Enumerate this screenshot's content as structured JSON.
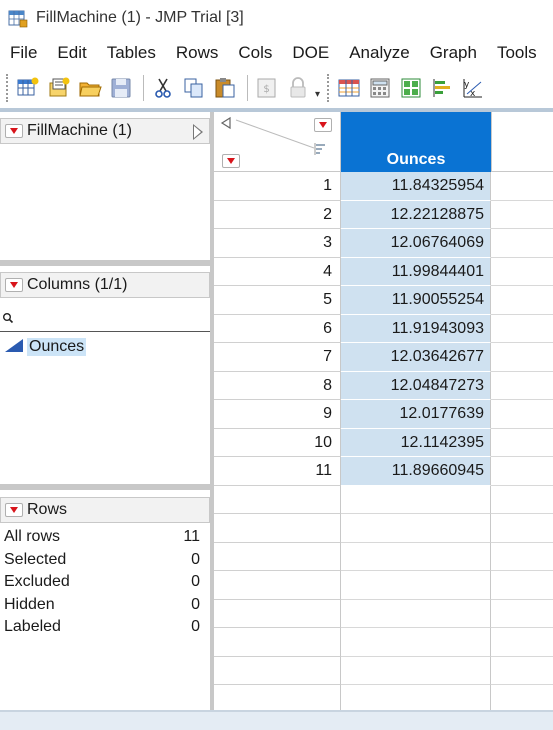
{
  "window": {
    "title": "FillMachine (1) - JMP Trial [3]"
  },
  "menu": [
    "File",
    "Edit",
    "Tables",
    "Rows",
    "Cols",
    "DOE",
    "Analyze",
    "Graph",
    "Tools"
  ],
  "toolbar": {
    "buttons": [
      "new-data-table-icon",
      "new-script-icon",
      "open-folder-icon",
      "save-icon",
      "cut-icon",
      "copy-icon",
      "paste-icon",
      "journal-icon",
      "lock-icon",
      "data-table-icon",
      "calculator-icon",
      "layout-icon",
      "bar-chart-icon",
      "regression-icon"
    ]
  },
  "table_panel": {
    "title": "FillMachine (1)"
  },
  "columns_panel": {
    "title": "Columns (1/1)",
    "search_placeholder": "",
    "items": [
      {
        "name": "Ounces",
        "type": "continuous"
      }
    ]
  },
  "rows_panel": {
    "title": "Rows",
    "stats": [
      {
        "label": "All rows",
        "value": "11"
      },
      {
        "label": "Selected",
        "value": "0"
      },
      {
        "label": "Excluded",
        "value": "0"
      },
      {
        "label": "Hidden",
        "value": "0"
      },
      {
        "label": "Labeled",
        "value": "0"
      }
    ]
  },
  "grid": {
    "column_header": "Ounces",
    "rows": [
      {
        "n": "1",
        "value": "11.84325954"
      },
      {
        "n": "2",
        "value": "12.22128875"
      },
      {
        "n": "3",
        "value": "12.06764069"
      },
      {
        "n": "4",
        "value": "11.99844401"
      },
      {
        "n": "5",
        "value": "11.90055254"
      },
      {
        "n": "6",
        "value": "11.91943093"
      },
      {
        "n": "7",
        "value": "12.03642677"
      },
      {
        "n": "8",
        "value": "12.04847273"
      },
      {
        "n": "9",
        "value": "12.0177639"
      },
      {
        "n": "10",
        "value": "12.1142395"
      },
      {
        "n": "11",
        "value": "11.89660945"
      }
    ]
  },
  "colors": {
    "header_blue": "#0a73d3",
    "cell_selected": "#cfe1f0",
    "menu_red": "#d8141b"
  }
}
